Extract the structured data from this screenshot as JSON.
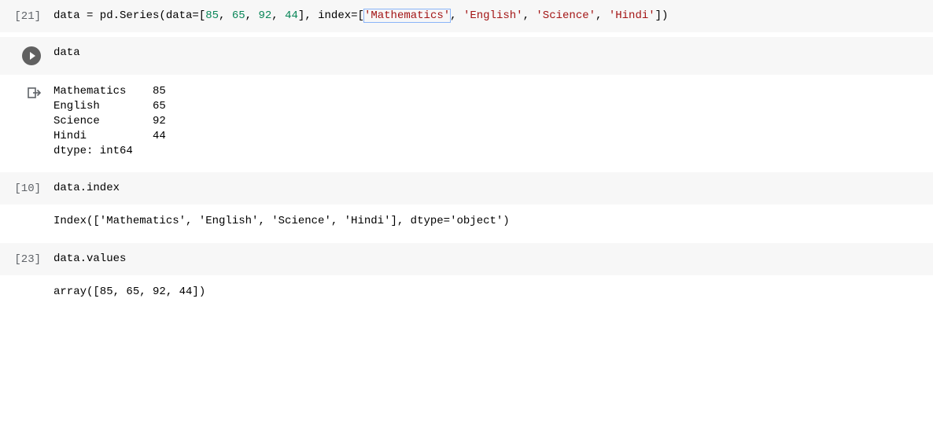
{
  "cells": {
    "c21": {
      "exec": "[21]",
      "code": {
        "p1": "data = pd.Series(data=[",
        "n1": "85",
        "s1": ", ",
        "n2": "65",
        "s2": ", ",
        "n3": "92",
        "s3": ", ",
        "n4": "44",
        "p2": "], index=[",
        "q1": "'Mathematics'",
        "s4": ", ",
        "q2": "'English'",
        "s5": ", ",
        "q3": "'Science'",
        "s6": ", ",
        "q4": "'Hindi'",
        "p3": "])"
      }
    },
    "c_run": {
      "code": "data",
      "output": "Mathematics    85\nEnglish        65\nScience        92\nHindi          44\ndtype: int64"
    },
    "c10": {
      "exec": "[10]",
      "code": "data.index",
      "output": "Index(['Mathematics', 'English', 'Science', 'Hindi'], dtype='object')"
    },
    "c23": {
      "exec": "[23]",
      "code": "data.values",
      "output": "array([85, 65, 92, 44])"
    }
  }
}
